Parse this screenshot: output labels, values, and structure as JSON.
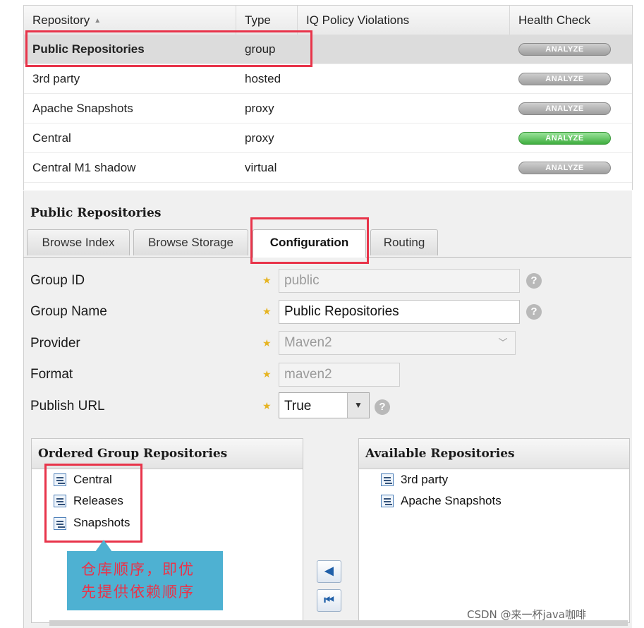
{
  "grid": {
    "columns": [
      "Repository",
      "Type",
      "IQ Policy Violations",
      "Health Check"
    ],
    "rows": [
      {
        "name": "Public Repositories",
        "type": "group",
        "analyze": "ANALYZE",
        "selected": true
      },
      {
        "name": "3rd party",
        "type": "hosted",
        "analyze": "ANALYZE"
      },
      {
        "name": "Apache Snapshots",
        "type": "proxy",
        "analyze": "ANALYZE"
      },
      {
        "name": "Central",
        "type": "proxy",
        "analyze": "ANALYZE",
        "analyze_color": "#4cbb4c"
      },
      {
        "name": "Central M1 shadow",
        "type": "virtual",
        "analyze": "ANALYZE"
      }
    ]
  },
  "panel": {
    "title": "Public Repositories",
    "tabs": [
      "Browse Index",
      "Browse Storage",
      "Configuration",
      "Routing"
    ],
    "active_tab": "Configuration"
  },
  "form": {
    "group_id": {
      "label": "Group ID",
      "value": "public"
    },
    "group_name": {
      "label": "Group Name",
      "value": "Public Repositories"
    },
    "provider": {
      "label": "Provider",
      "value": "Maven2"
    },
    "format": {
      "label": "Format",
      "value": "maven2"
    },
    "publish_url": {
      "label": "Publish URL",
      "value": "True"
    }
  },
  "ordered": {
    "title": "Ordered Group Repositories",
    "items": [
      "Central",
      "Releases",
      "Snapshots"
    ]
  },
  "available": {
    "title": "Available Repositories",
    "items": [
      "3rd party",
      "Apache Snapshots"
    ]
  },
  "annotation": {
    "line1": "仓库顺序，即优",
    "line2": "先提供依赖顺序"
  },
  "watermark": "CSDN @来一杯java咖啡",
  "colors": {
    "highlight": "#e8344a",
    "callout": "#4eb1d2",
    "analyze_green": "#4cbb4c"
  }
}
